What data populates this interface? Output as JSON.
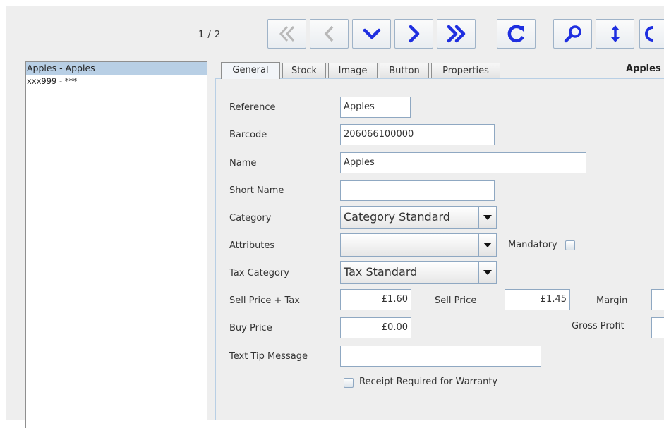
{
  "toolbar": {
    "record_counter": "1 / 2",
    "buttons": [
      "first-record",
      "previous-record",
      "down",
      "next-record",
      "last-record",
      "reload",
      "search",
      "sort",
      "more"
    ]
  },
  "list": {
    "items": [
      {
        "label": "Apples - Apples",
        "selected": true
      },
      {
        "label": "xxx999 - ***",
        "selected": false
      }
    ]
  },
  "tabs": [
    {
      "label": "General",
      "active": true
    },
    {
      "label": "Stock",
      "active": false
    },
    {
      "label": "Image",
      "active": false
    },
    {
      "label": "Button",
      "active": false
    },
    {
      "label": "Properties",
      "active": false
    }
  ],
  "header": {
    "product_title": "Apples"
  },
  "form": {
    "reference_label": "Reference",
    "reference_value": "Apples",
    "barcode_label": "Barcode",
    "barcode_value": "206066100000",
    "name_label": "Name",
    "name_value": "Apples",
    "short_name_label": "Short Name",
    "short_name_value": "",
    "category_label": "Category",
    "category_value": "Category Standard",
    "attributes_label": "Attributes",
    "attributes_value": "",
    "mandatory_label": "Mandatory",
    "tax_category_label": "Tax Category",
    "tax_category_value": "Tax Standard",
    "sell_price_tax_label": "Sell Price + Tax",
    "sell_price_tax_value": "£1.60",
    "sell_price_label": "Sell Price",
    "sell_price_value": "£1.45",
    "margin_label": "Margin",
    "buy_price_label": "Buy Price",
    "buy_price_value": "£0.00",
    "gross_profit_label": "Gross Profit",
    "text_tip_label": "Text Tip Message",
    "text_tip_value": "",
    "warranty_label": "Receipt Required for Warranty"
  },
  "colors": {
    "accent": "#1f2fe0",
    "selection": "#b8cfe5",
    "disabled_icon": "#b8b8b8"
  }
}
